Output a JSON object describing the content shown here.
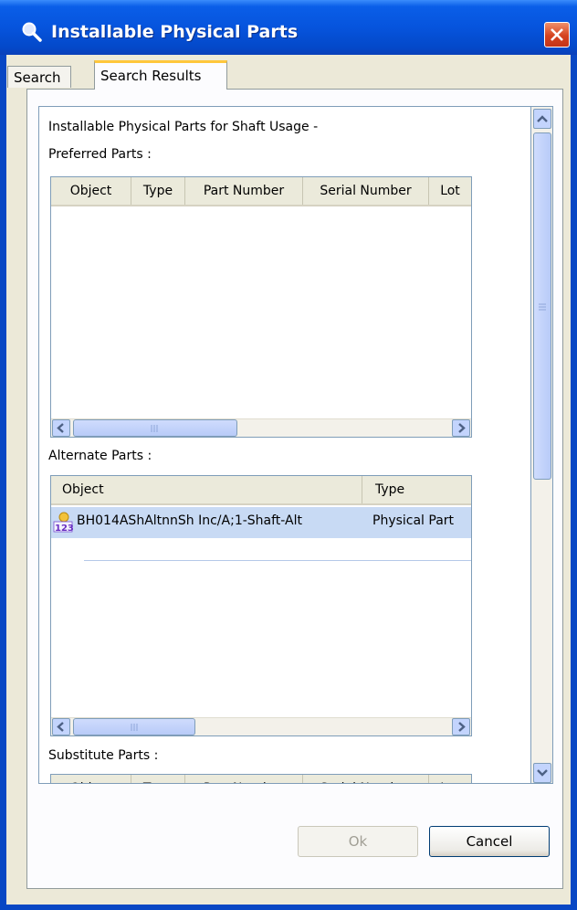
{
  "window": {
    "title": "Installable Physical Parts"
  },
  "tabs": [
    {
      "label": "Search"
    },
    {
      "label": "Search Results"
    }
  ],
  "content": {
    "heading": "Installable Physical Parts for Shaft Usage -",
    "preferred": {
      "label": "Preferred Parts :",
      "columns": [
        "Object",
        "Type",
        "Part Number",
        "Serial Number",
        "Lot"
      ]
    },
    "alternate": {
      "label": "Alternate Parts :",
      "columns": [
        "Object",
        "Type"
      ],
      "rows": [
        {
          "object": "BH014AShAltnnSh Inc/A;1-Shaft-Alt",
          "type": "Physical Part",
          "icon": "physical-part-icon"
        }
      ]
    },
    "substitute": {
      "label": "Substitute Parts :",
      "columns": [
        "Object",
        "Type",
        "Part Number",
        "Serial Number",
        "Lot"
      ]
    }
  },
  "buttons": {
    "ok": "Ok",
    "cancel": "Cancel"
  },
  "colors": {
    "title_bar": "#0654dd",
    "selection": "#c8daf4",
    "dialog_bg": "#ece9d8"
  }
}
